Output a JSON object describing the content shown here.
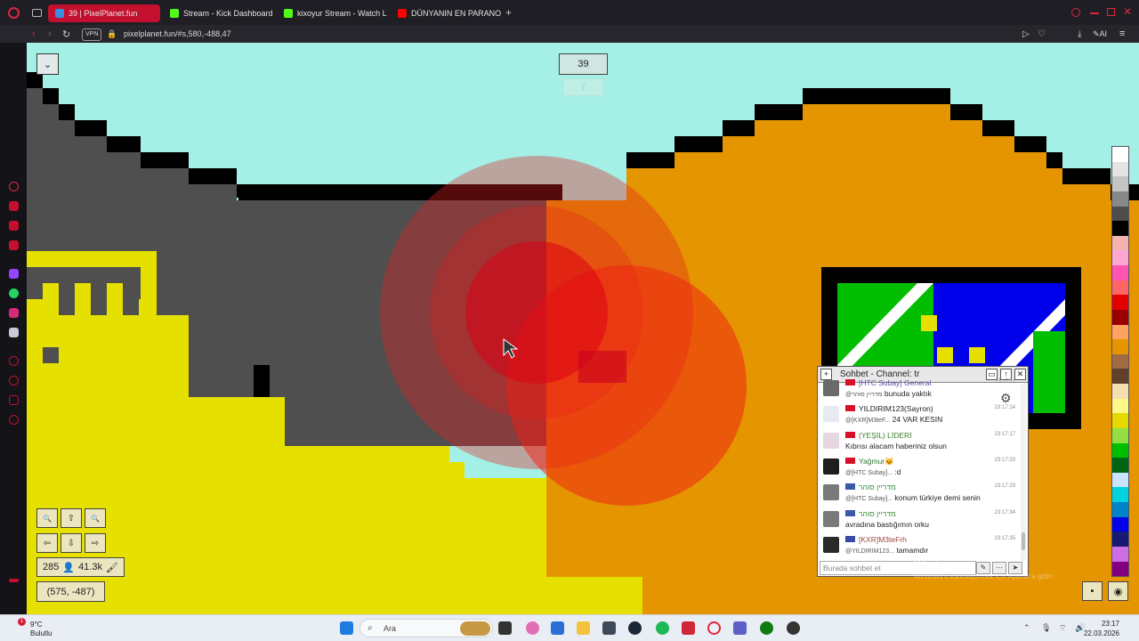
{
  "browser": {
    "tabs": [
      {
        "label": "39 | PixelPlanet.fun",
        "active": true,
        "icon": "pixelplanet-icon"
      },
      {
        "label": "Stream - Kick Dashboard",
        "active": false,
        "icon": "kick-icon"
      },
      {
        "label": "kixoyur Stream - Watch Li",
        "active": false,
        "icon": "kick-icon"
      },
      {
        "label": "DÜNYANIN EN PARANORM",
        "active": false,
        "icon": "youtube-icon"
      }
    ],
    "new_tab": "+",
    "url": "pixelplanet.fun/#s,580,-488,47",
    "vpn": "VPN",
    "ai": "AI",
    "accent": "#c4102e"
  },
  "game": {
    "online_count": "39",
    "counter_sub": "7",
    "collapse_btn": "⌄",
    "zoom_out": "🔍",
    "up": "⇧",
    "zoom_in": "🔍",
    "left": "⇦",
    "down": "⇩",
    "right": "⇨",
    "pixels": "285",
    "total": "41.3k",
    "coords": "(575, -487)",
    "palette": [
      "#ffffff",
      "#e4e4e4",
      "#c4c4c4",
      "#888888",
      "#4e4e4e",
      "#000000",
      "#f4b3ae",
      "#ffa7d1",
      "#ff54b2",
      "#ff6565",
      "#e50000",
      "#9a0000",
      "#fea460",
      "#e59500",
      "#a06a42",
      "#604028",
      "#f5dfb0",
      "#fff889",
      "#e5d900",
      "#94e044",
      "#02be01",
      "#006513",
      "#cae3ff",
      "#00d3dd",
      "#0083c7",
      "#0000ea",
      "#191973",
      "#cf6ee4",
      "#820080"
    ]
  },
  "chat": {
    "title": "Sohbet - Channel: tr",
    "input_placeholder": "Burada sohbet et",
    "messages": [
      {
        "name": "[HTC Subay] General",
        "time": "23:17:11",
        "mention": "@מדריין סוהר",
        "text": "bunuda yaktık",
        "name_color": "#5a4ea8",
        "avatar": "#6a6a6a",
        "flag": "#d8102a"
      },
      {
        "name": "YILDIRIM123(Sayron)",
        "time": "23:17:14",
        "mention": "@[KXR]M3teF...",
        "text": "24 VAR KESIN",
        "name_color": "#222222",
        "avatar": "#e8eaf2",
        "flag": "#d8102a"
      },
      {
        "name": "(YEŞİL) LİDERİ",
        "time": "23:17:17",
        "mention": "",
        "text": "Kıbrısı alacam haberiniz olsun",
        "name_color": "#3a7d2c",
        "avatar": "#e6d6e0",
        "flag": "#d8102a"
      },
      {
        "name": "Yağmur🐱",
        "time": "23:17:20",
        "mention": "@[HTC Subay]...",
        "text": ":d",
        "name_color": "#2c7a2c",
        "avatar": "#1e1e1e",
        "flag": "#d8102a"
      },
      {
        "name": "מדריין סוהר",
        "time": "23:17:29",
        "mention": "@[HTC Subay]...",
        "text": "konum türkiye demi senin",
        "name_color": "#3a8a3a",
        "avatar": "#7a7a7a",
        "flag": "#3a5aa8"
      },
      {
        "name": "מדריין סוהר",
        "time": "23:17:34",
        "mention": "",
        "text": "avradına bastığımın orku",
        "name_color": "#3a8a3a",
        "avatar": "#7a7a7a",
        "flag": "#3a5aa8"
      },
      {
        "name": "[KXR]M3teFrh",
        "time": "23:17:35",
        "mention": "@YILDIRIM123...",
        "text": "tamamdır",
        "name_color": "#9a4a3a",
        "avatar": "#2a2a2a",
        "flag": "#3a4aa8"
      }
    ]
  },
  "windows": {
    "watermark": "Windows u",
    "watermark_sub": "Windows'u etkinleştirmek için Ayarlar'a gidin.",
    "weather_temp": "9°C",
    "weather_desc": "Bulutlu",
    "notif": "1",
    "search": "Ara",
    "time": "23:17",
    "date": "22.03.2026"
  }
}
